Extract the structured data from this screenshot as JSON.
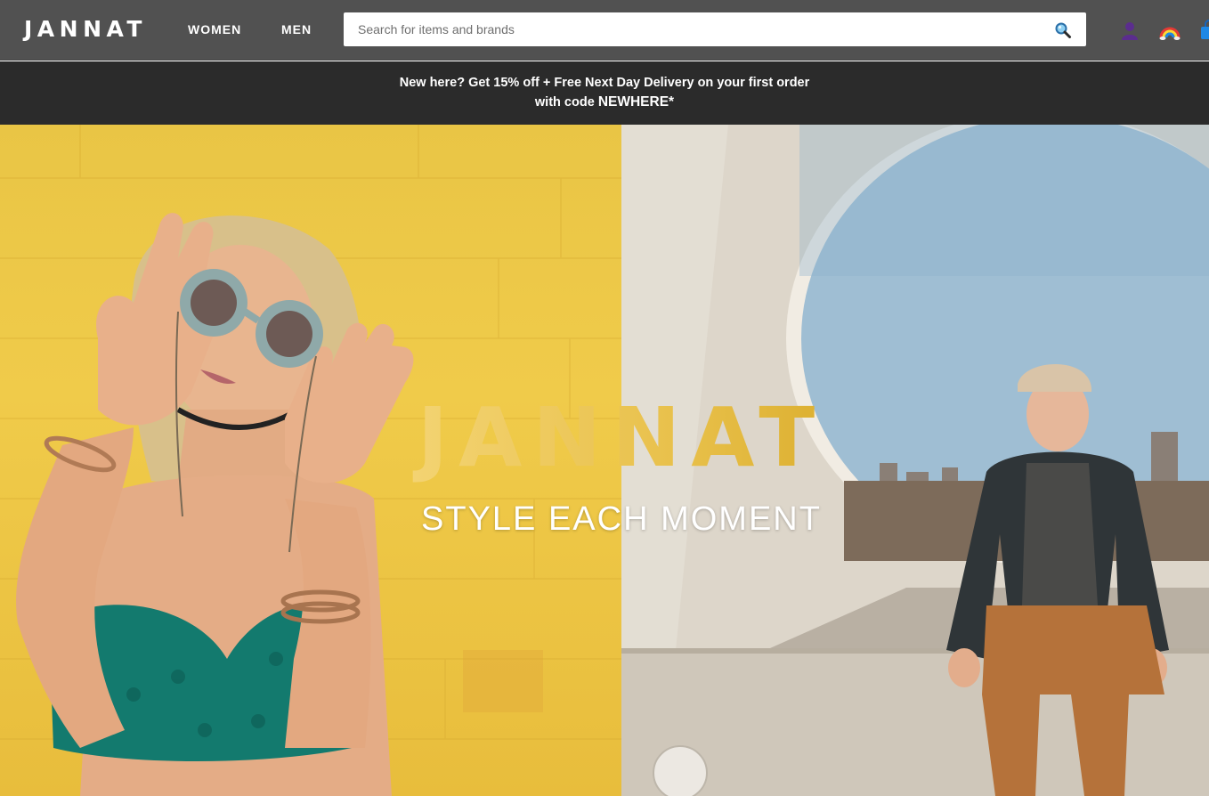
{
  "header": {
    "logo": "JANNAT",
    "nav": [
      {
        "label": "WOMEN"
      },
      {
        "label": "MEN"
      }
    ],
    "search": {
      "placeholder": "Search for items and brands",
      "value": ""
    },
    "icons": [
      "account-icon",
      "rainbow-icon",
      "shopping-bag-icon"
    ]
  },
  "promo": {
    "line1": "New here? Get 15% off + Free Next Day Delivery on your first order",
    "line2_prefix": "with code ",
    "code": "NEWHERE*"
  },
  "hero": {
    "brand": "JANNAT",
    "tagline": "STYLE EACH MOMENT"
  },
  "colors": {
    "topbar": "#515151",
    "promo_bg": "#2b2b2b",
    "brand_gold": "#d4a41e"
  }
}
